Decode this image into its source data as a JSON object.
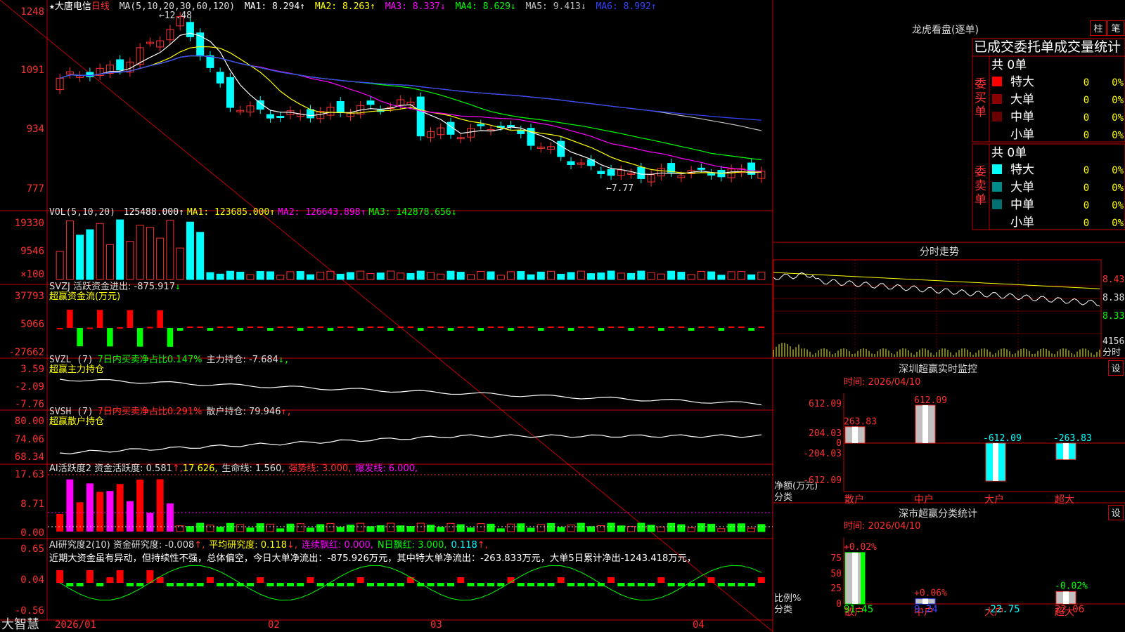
{
  "stock": {
    "name": "大唐电信",
    "period": "日线"
  },
  "legend": {
    "ma_params": "MA(5,10,20,30,60,120)",
    "ma": [
      {
        "label": "MA1: 8.294",
        "arrow": "↑",
        "color": "#ffffff"
      },
      {
        "label": "MA2: 8.263",
        "arrow": "↑",
        "color": "#ffff00"
      },
      {
        "label": "MA3: 8.337",
        "arrow": "↓",
        "color": "#ff00ff"
      },
      {
        "label": "MA4: 8.629",
        "arrow": "↓",
        "color": "#00ff00"
      },
      {
        "label": "MA5: 9.413",
        "arrow": "↓",
        "color": "#c0c0c0"
      },
      {
        "label": "MA6: 8.992",
        "arrow": "↑",
        "color": "#3344ff"
      }
    ],
    "vol_params": "VOL(5,10,20)",
    "vol": [
      {
        "label": "125488.000",
        "arrow": "↑",
        "color": "#ffffff"
      },
      {
        "label": "MA1: 123685.000",
        "arrow": "↑",
        "color": "#ffff00"
      },
      {
        "label": "MA2: 126643.898",
        "arrow": "↑",
        "color": "#ff00ff"
      },
      {
        "label": "MA3: 142878.656",
        "arrow": "↓",
        "color": "#00ff00"
      }
    ],
    "svzj_title": "SVZJ  活跃资金进出: -875.917",
    "svzj_arrow": "↓",
    "svzj_sub": "超赢资金流(万元)",
    "svzl_title": "SVZL (7)",
    "svzl_a": "7日内买卖净占比0.147%",
    "svzl_b": "主力持仓: -7.684",
    "svzl_arrow": "↓,",
    "svzl_sub": "超赢主力持仓",
    "svsh_title": "SVSH (7)",
    "svsh_a": "7日内买卖净占比0.291%",
    "svsh_b": "散户持仓: 79.946",
    "svsh_arrow": "↑,",
    "svsh_sub": "超赢散户持仓",
    "ai_title": "AI活跃度2 资金活跃度: 0.581",
    "ai_b": "17.626,",
    "ai_c": "生命线: 1.560,",
    "ai_d": "强势线: 3.000,",
    "ai_e": "爆发线: 6.000,",
    "yj_title": "AI研究度2(10) 资金研究度: -0.008",
    "yj_b": "平均研究度: 0.118",
    "yj_c": "连续飘红: 0.000,",
    "yj_d": "N日飘红: 3.000,",
    "yj_e": "0.118",
    "yj_text": "近期大资金虽有异动，但持续性不强，总体偏空，今日大单净流出：-875.926万元，其中特大单净流出：-263.833万元，大单5日累计净出-1243.418万元，"
  },
  "axis": {
    "price": [
      "1248",
      "1091",
      "934",
      "777"
    ],
    "vol": [
      "19330",
      "9546",
      "×100"
    ],
    "svzj": [
      "37793",
      "5066",
      "-27662"
    ],
    "svzl": [
      "3.59",
      "-2.09",
      "-7.76"
    ],
    "svsh": [
      "80.00",
      "74.06",
      "68.34"
    ],
    "ai": [
      "17.63",
      "8.71",
      "0.00"
    ],
    "yj": [
      "0.65",
      "0.04",
      "-0.56"
    ],
    "dates": [
      "2026/01",
      "02",
      "03",
      "04"
    ]
  },
  "annotations": {
    "high": "12.48",
    "low": "7.77"
  },
  "brand": "大智慧",
  "longhu": {
    "title": "龙虎看盘(逐单)",
    "btn1": "柱",
    "btn2": "笔",
    "header": "已成交委托单成交量统计",
    "buy_label": "委买单",
    "sell_label": "委卖单",
    "total": "共 0单",
    "rows": [
      {
        "name": "特大",
        "count": "0",
        "pct": "0%"
      },
      {
        "name": "大单",
        "count": "0",
        "pct": "0%"
      },
      {
        "name": "中单",
        "count": "0",
        "pct": "0%"
      },
      {
        "name": "小单",
        "count": "0",
        "pct": "0%"
      }
    ],
    "buy_colors": [
      "#ff0000",
      "#8b0000",
      "#6b0000",
      "#000000"
    ],
    "sell_colors": [
      "#00ffff",
      "#008b8b",
      "#007070",
      "#000000"
    ]
  },
  "fenshi": {
    "title": "分时走势",
    "prices": [
      "8.43",
      "8.38",
      "8.33"
    ],
    "vol": "4156",
    "unit": "分时"
  },
  "monitor": {
    "title": "深圳超赢实时监控",
    "btn": "设",
    "time": "时间: 2026/04/10",
    "ylabel": "净额(万元)",
    "xlabel": "分类",
    "ticks": [
      "612.09",
      "204.03",
      "0",
      "-204.03",
      "-612.09"
    ]
  },
  "stats": {
    "title": "深市超赢分类统计",
    "btn": "设",
    "time": "时间: 2026/04/10",
    "ylabel": "比例%",
    "xlabel": "分类",
    "ticks": [
      "75",
      "50",
      "25",
      "0"
    ]
  },
  "chart_data": [
    {
      "type": "bar",
      "title": "深圳超赢实时监控",
      "categories": [
        "散户",
        "中户",
        "大户",
        "超大"
      ],
      "values": [
        263.83,
        612.09,
        -612.09,
        -263.83
      ],
      "value_labels": [
        "263.83",
        "612.09",
        "-612.09",
        "-263.83"
      ],
      "ylabel": "净额(万元)",
      "ylim": [
        -612.09,
        612.09
      ]
    },
    {
      "type": "bar",
      "title": "深市超赢分类统计",
      "categories": [
        "散户",
        "中户",
        "大户",
        "超大"
      ],
      "values": [
        91.45,
        9.24,
        -22.75,
        22.06
      ],
      "change_labels": [
        "+0.02%",
        "+0.06%",
        "",
        "-0.02%"
      ],
      "value_labels": [
        "91.45",
        "9.24",
        "-22.75",
        "22.06"
      ],
      "ylabel": "比例%",
      "ylim": [
        0,
        100
      ]
    }
  ]
}
